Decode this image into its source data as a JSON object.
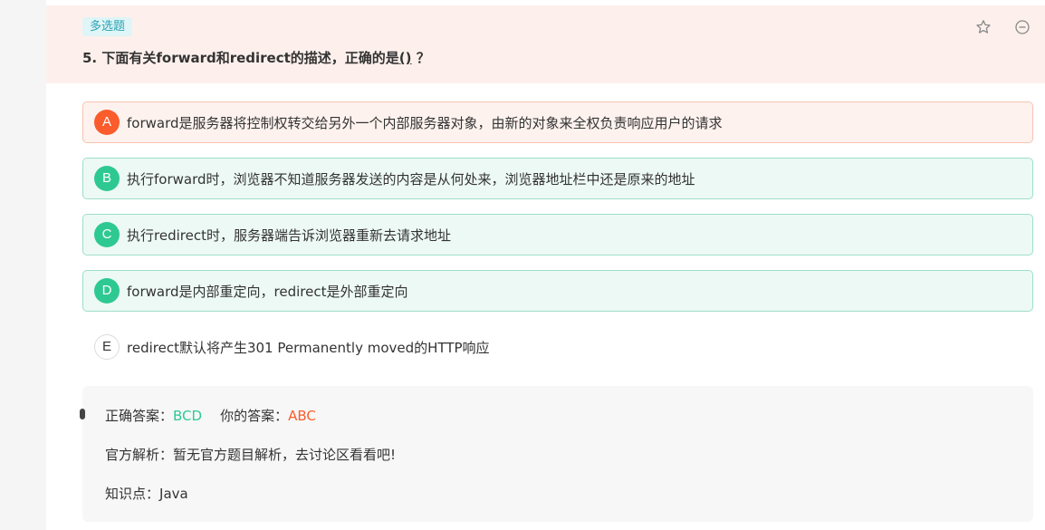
{
  "question": {
    "type_tag": "多选题",
    "title_prefix": "5. 下面有关forward和redirect的描述，正确的是",
    "title_blank": "()",
    "title_suffix": " ？"
  },
  "header_icons": [
    "star-icon",
    "collapse-icon"
  ],
  "options": [
    {
      "letter": "A",
      "text": "forward是服务器将控制权转交给另外一个内部服务器对象，由新的对象来全权负责响应用户的请求",
      "state": "wrong"
    },
    {
      "letter": "B",
      "text": "执行forward时，浏览器不知道服务器发送的内容是从何处来，浏览器地址栏中还是原来的地址",
      "state": "right"
    },
    {
      "letter": "C",
      "text": "执行redirect时，服务器端告诉浏览器重新去请求地址",
      "state": "right"
    },
    {
      "letter": "D",
      "text": "forward是内部重定向，redirect是外部重定向",
      "state": "right"
    },
    {
      "letter": "E",
      "text": "redirect默认将产生301 Permanently moved的HTTP响应",
      "state": "none"
    }
  ],
  "answer": {
    "correct_label": "正确答案：",
    "correct_value": "BCD",
    "yours_label": "你的答案：",
    "yours_value": "ABC",
    "analysis_label": "官方解析：",
    "analysis_text": "暂无官方题目解析，去讨论区看看吧!",
    "knowledge_label": "知识点：",
    "knowledge_value": "Java"
  },
  "colors": {
    "wrong": "#fa5c2c",
    "right": "#2ec992",
    "header_bg": "#fdf0ec",
    "tag_bg": "#dff5f7"
  }
}
